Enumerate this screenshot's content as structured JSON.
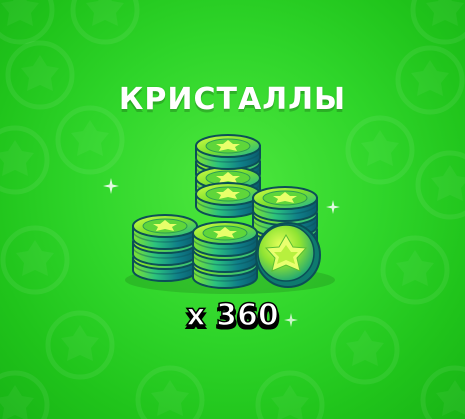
{
  "reward": {
    "title": "КРИСТАЛЛЫ",
    "quantity": "x 360"
  },
  "icons": {
    "background_pattern": "gem-badge-icon",
    "item": "gem-coin-stack-icon",
    "sparkle": "sparkle-icon"
  },
  "colors": {
    "background": "#2fd52a",
    "gem_dark": "#0f6c6b",
    "gem_mid": "#14b8a0",
    "gem_light": "#b8f13a",
    "text": "#ffffff"
  }
}
